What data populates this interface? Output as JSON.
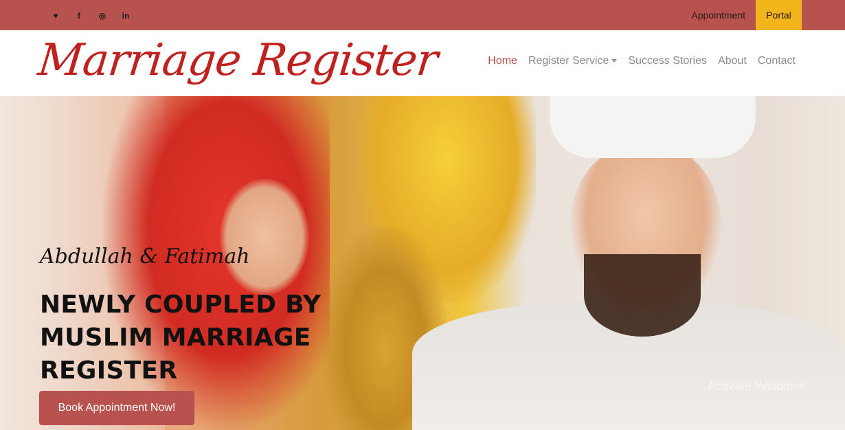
{
  "topbar": {
    "social_icons": [
      "twitter-icon",
      "facebook-icon",
      "instagram-icon",
      "linkedin-icon"
    ],
    "social_glyphs": [
      "♥",
      "f",
      "◎",
      "in"
    ],
    "appointment_label": "Appointment",
    "portal_label": "Portal"
  },
  "brand": {
    "logo_text": "Marriage Register"
  },
  "nav": {
    "items": [
      {
        "label": "Home",
        "active": true
      },
      {
        "label": "Register Service",
        "dropdown": true
      },
      {
        "label": "Success Stories"
      },
      {
        "label": "About"
      },
      {
        "label": "Contact"
      }
    ]
  },
  "hero": {
    "script_text": "Abdullah & Fatimah",
    "headline": "NEWLY COUPLED BY MUSLIM MARRIAGE REGISTER",
    "cta_label": "Book Appointment Now!",
    "watermark_text": "Activate Windows"
  },
  "colors": {
    "topbar": "#b8524e",
    "portal": "#f2b51c",
    "logo": "#c0211e",
    "nav_active": "#b8524e",
    "nav_text": "#8a8a8a",
    "cta": "#b8524e"
  }
}
